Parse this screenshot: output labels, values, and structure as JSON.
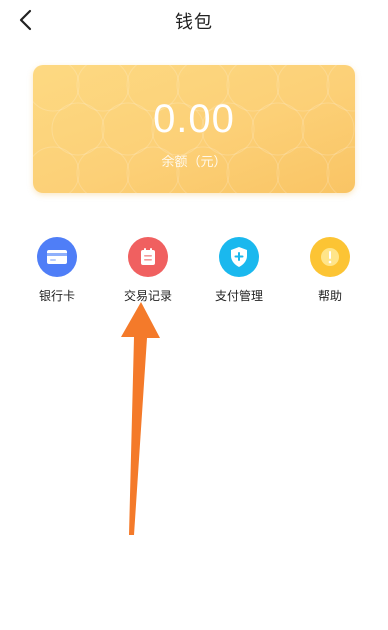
{
  "header": {
    "title": "钱包",
    "back_icon": "chevron-left-icon"
  },
  "balance_card": {
    "amount": "0.00",
    "label": "余额（元）",
    "gradient_colors": [
      "#fdd982",
      "#f9c464"
    ]
  },
  "actions": [
    {
      "label": "银行卡",
      "icon": "bank-card-icon",
      "color": "#4f7ef7"
    },
    {
      "label": "交易记录",
      "icon": "transaction-record-icon",
      "color": "#f06060"
    },
    {
      "label": "支付管理",
      "icon": "shield-plus-icon",
      "color": "#1ab8ee"
    },
    {
      "label": "帮助",
      "icon": "help-icon",
      "color": "#fcc434"
    }
  ],
  "annotation": {
    "type": "arrow",
    "color": "#f47a2a",
    "points_to": "交易记录"
  }
}
